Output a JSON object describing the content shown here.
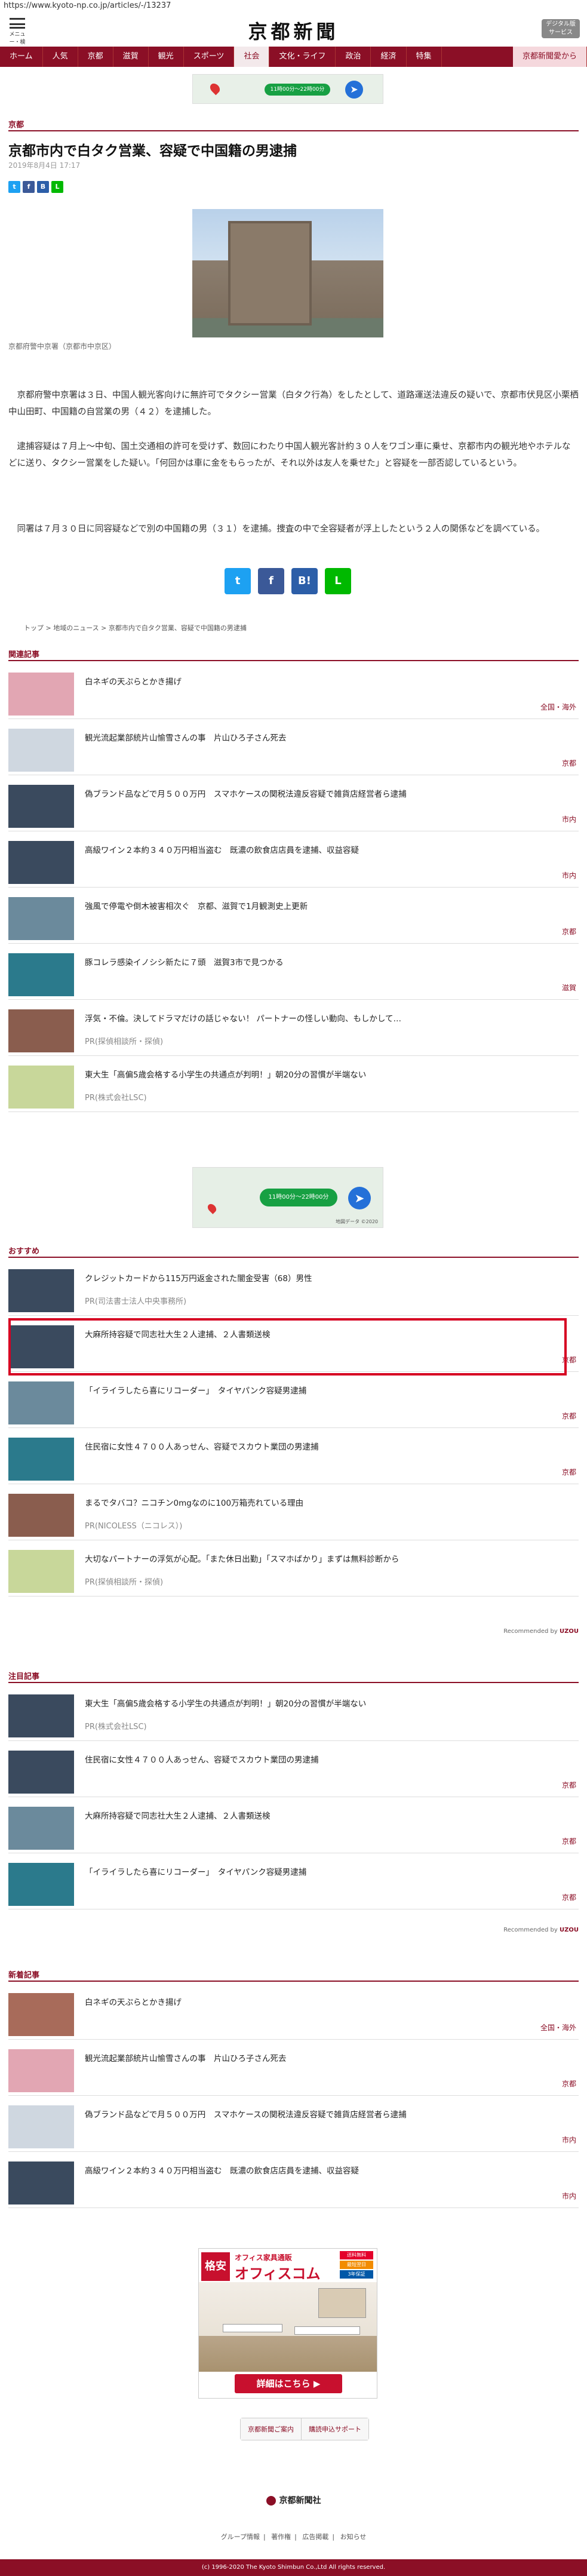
{
  "url": "https://www.kyoto-np.co.jp/articles/-/13237",
  "header": {
    "menu_label": "メニュー・検索",
    "logo": "京都新聞",
    "digital_label": "デジタル版\nサービス"
  },
  "nav": [
    "ホーム",
    "人気",
    "京都",
    "滋賀",
    "観光",
    "スポーツ",
    "社会",
    "文化・ライフ",
    "政治",
    "経済",
    "特集"
  ],
  "nav_active": "社会",
  "nav_special": "京都新聞愛から",
  "top_ad": {
    "text": "11時00分～22時00分"
  },
  "section": "京都",
  "article": {
    "headline": "京都市内で白タク営業、容疑で中国籍の男逮捕",
    "date": "2019年8月4日 17:17",
    "caption": "京都府警中京署（京都市中京区）",
    "paragraphs": [
      "　京都府警中京署は３日、中国人観光客向けに無許可でタクシー営業（白タク行為）をしたとして、道路運送法違反の疑いで、京都市伏見区小栗栖中山田町、中国籍の自営業の男（４２）を逮捕した。",
      "　逮捕容疑は７月上～中旬、国土交通相の許可を受けず、数回にわたり中国人観光客計約３０人をワゴン車に乗せ、京都市内の観光地やホテルなどに送り、タクシー営業をした疑い。「何回かは車に金をもらったが、それ以外は友人を乗せた」と容疑を一部否認しているという。",
      "　同署は７月３０日に同容疑などで別の中国籍の男（３１）を逮捕。捜査の中で全容疑者が浮上したという２人の関係などを調べている。"
    ]
  },
  "breadcrumb": [
    "トップ",
    "地域のニュース",
    "京都市内で白タク営業、容疑で中国籍の男逮捕"
  ],
  "related": {
    "label": "関連記事",
    "items": [
      {
        "title": "白ネギの天ぷらとかき揚げ",
        "tag": "全国・海外"
      },
      {
        "title": "観光流起業部統片山愉雪さんの事　片山ひろ子さん死去",
        "tag": "京都"
      },
      {
        "title": "偽ブランド品などで月５００万円　スマホケースの関税法違反容疑で雑貨店経営者ら逮捕",
        "tag": "市内"
      },
      {
        "title": "高級ワイン２本約３４０万円相当盗む　既濃の飲食店店員を逮捕、収益容疑",
        "tag": "市内"
      },
      {
        "title": "強風で停電や倒木被害相次ぐ　京都、滋賀で1月観測史上更新",
        "tag": "京都"
      },
      {
        "title": "豚コレラ感染イノシシ新たに７頭　滋賀3市で見つかる",
        "tag": "滋賀"
      },
      {
        "title": "浮気・不倫。決してドラマだけの話じゃない！ パートナーの怪しい動向、もしかして…",
        "sponsor": "PR(探偵相談所・探偵)"
      },
      {
        "title": "東大生「高偏5歳会格する小学生の共通点が判明！」朝20分の習慣が半端ない",
        "sponsor": "PR(株式会社LSC)"
      }
    ]
  },
  "map_ad": {
    "text": "11時00分～22時00分",
    "credit": "地図データ ©2020"
  },
  "recommend": {
    "label": "おすすめ",
    "items": [
      {
        "title": "クレジットカードから115万円返金された闇金受害（68）男性",
        "sponsor": "PR(司法書士法人中央事務所)"
      },
      {
        "title": "大麻所持容疑で同志社大生２人逮捕、２人書類送検",
        "tag": "京都"
      },
      {
        "title": "「イライラしたら喜にリコーダー」　タイヤパンク容疑男逮捕",
        "tag": "京都"
      },
      {
        "title": "住民宿に女性４７００人あっせん、容疑でスカウト業団の男逮捕",
        "tag": "京都"
      },
      {
        "title": "まるでタバコ？ニコチン0mgなのに100万箱売れている理由",
        "sponsor": "PR(NICOLESS（ニコレス）)"
      },
      {
        "title": "大切なパートナーの浮気が心配。「また休日出勤」「スマホばかり」まずは無料診断から",
        "sponsor": "PR(探偵相談所・探偵)"
      }
    ],
    "credit_label": "Recommended by",
    "credit_brand": "UZOU"
  },
  "attention": {
    "label": "注目記事",
    "items": [
      {
        "title": "東大生「高偏5歳会格する小学生の共通点が判明！」朝20分の習慣が半端ない",
        "sponsor": "PR(株式会社LSC)"
      },
      {
        "title": "住民宿に女性４７００人あっせん、容疑でスカウト業団の男逮捕",
        "tag": "京都"
      },
      {
        "title": "大麻所持容疑で同志社大生２人逮捕、２人書類送検",
        "tag": "京都"
      },
      {
        "title": "「イライラしたら喜にリコーダー」　タイヤパンク容疑男逮捕",
        "tag": "京都"
      }
    ],
    "credit_label": "Recommended by",
    "credit_brand": "UZOU"
  },
  "latest": {
    "label": "新着記事",
    "items": [
      {
        "title": "白ネギの天ぷらとかき揚げ",
        "tag": "全国・海外"
      },
      {
        "title": "観光流起業部統片山愉雪さんの事　片山ひろ子さん死去",
        "tag": "京都"
      },
      {
        "title": "偽ブランド品などで月５００万円　スマホケースの関税法違反容疑で雑貨店経営者ら逮捕",
        "tag": "市内"
      },
      {
        "title": "高級ワイン２本約３４０万円相当盗む　既濃の飲食店店員を逮捕、収益容疑",
        "tag": "市内"
      }
    ]
  },
  "bottom_ad": {
    "kakuyasu": "格安",
    "office": "オフィス家具通販",
    "brand": "オフィスコム",
    "cta": "詳細はこちら ▶",
    "badges": [
      "送料無料",
      "最短翌日",
      "3年保証"
    ]
  },
  "bottom_buttons": [
    "京都新聞ご案内",
    "購読申込サポート"
  ],
  "footer": {
    "logo": "京都新聞社",
    "links": [
      "グループ情報",
      "著作権",
      "広告掲載",
      "お知らせ"
    ],
    "copyright": "(c) 1996-2020 The Kyoto Shimbun Co.,Ltd All rights reserved."
  },
  "colors": {
    "brand": "#8b0f26",
    "highlight": "#d60022"
  }
}
